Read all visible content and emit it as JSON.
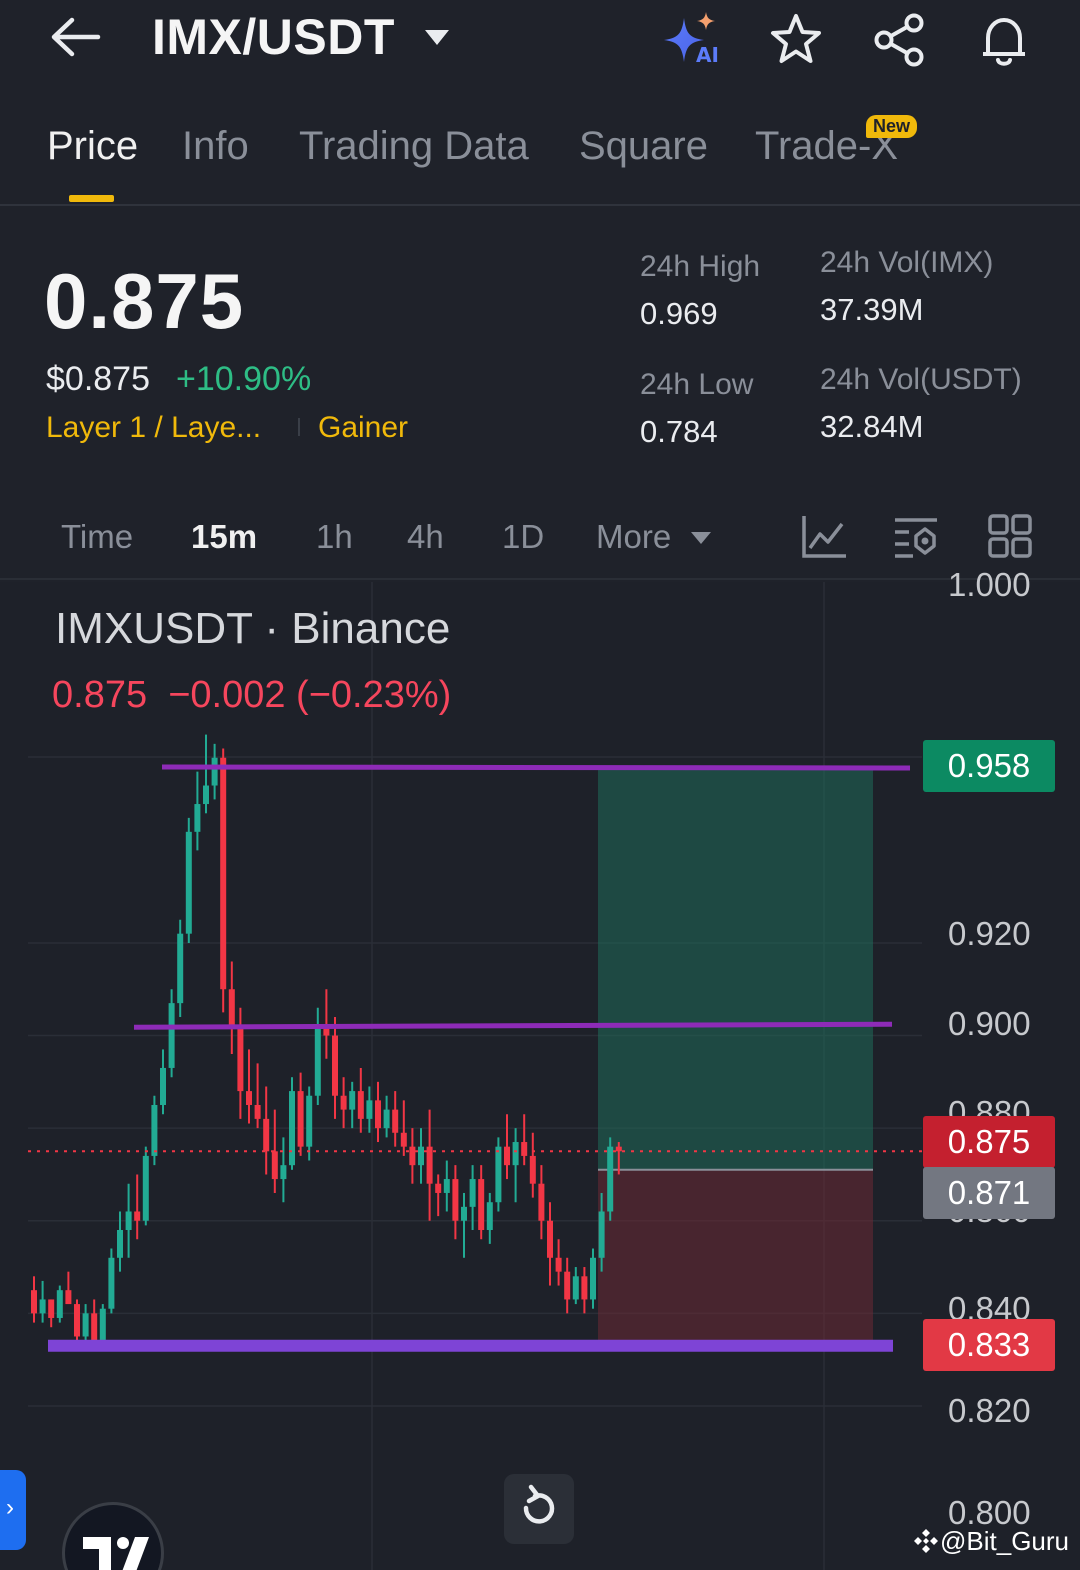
{
  "header": {
    "pair": "IMX/USDT",
    "icons": [
      "back-arrow-icon",
      "chevron-down-icon",
      "ai-sparkle-icon",
      "star-icon",
      "share-icon",
      "bell-icon"
    ]
  },
  "tabs": [
    {
      "label": "Price",
      "active": true
    },
    {
      "label": "Info"
    },
    {
      "label": "Trading Data"
    },
    {
      "label": "Square"
    },
    {
      "label": "Trade-X",
      "badge": "New"
    }
  ],
  "ticker": {
    "last": "0.875",
    "usd": "$0.875",
    "change": "+10.90%",
    "tag_sector": "Layer 1 / Laye...",
    "tag_gainer": "Gainer",
    "high_label": "24h High",
    "high": "0.969",
    "low_label": "24h Low",
    "low": "0.784",
    "vol_base_label": "24h Vol(IMX)",
    "vol_base": "37.39M",
    "vol_quote_label": "24h Vol(USDT)",
    "vol_quote": "32.84M"
  },
  "intervals": {
    "items": [
      "Time",
      "15m",
      "1h",
      "4h",
      "1D"
    ],
    "active": "15m",
    "more": "More",
    "tools": [
      "indicator-chart-icon",
      "chart-settings-icon",
      "layout-grid-icon"
    ]
  },
  "chart": {
    "title": "IMXUSDT · Binance",
    "ohlc": "0.875  −0.002 (−0.23%)",
    "y_ticks": [
      "1.000",
      "0.920",
      "0.900",
      "0.880",
      "0.860",
      "0.840",
      "0.820",
      "0.800"
    ],
    "tags": {
      "tp": "0.958",
      "last": "0.875",
      "entry": "0.871",
      "sl": "0.833"
    },
    "watermark": "@Bit_Guru"
  },
  "chart_data": {
    "type": "candlestick",
    "title": "IMXUSDT · Binance",
    "interval": "15m",
    "y_axis_ticks": [
      1.0,
      0.92,
      0.9,
      0.88,
      0.86,
      0.84,
      0.82,
      0.8
    ],
    "last_price": 0.875,
    "annotations": {
      "horizontal_lines": [
        0.958,
        0.902,
        0.833
      ],
      "long_position": {
        "entry": 0.871,
        "take_profit": 0.958,
        "stop_loss": 0.833
      }
    },
    "candles": [
      [
        0.845,
        0.848,
        0.838,
        0.84
      ],
      [
        0.84,
        0.847,
        0.838,
        0.843
      ],
      [
        0.843,
        0.843,
        0.837,
        0.839
      ],
      [
        0.839,
        0.846,
        0.838,
        0.845
      ],
      [
        0.845,
        0.849,
        0.843,
        0.842
      ],
      [
        0.842,
        0.843,
        0.834,
        0.835
      ],
      [
        0.835,
        0.842,
        0.834,
        0.84
      ],
      [
        0.84,
        0.843,
        0.833,
        0.834
      ],
      [
        0.834,
        0.842,
        0.833,
        0.841
      ],
      [
        0.841,
        0.854,
        0.84,
        0.852
      ],
      [
        0.852,
        0.862,
        0.849,
        0.858
      ],
      [
        0.858,
        0.868,
        0.852,
        0.862
      ],
      [
        0.862,
        0.87,
        0.856,
        0.86
      ],
      [
        0.86,
        0.876,
        0.859,
        0.874
      ],
      [
        0.874,
        0.887,
        0.872,
        0.885
      ],
      [
        0.885,
        0.897,
        0.883,
        0.893
      ],
      [
        0.893,
        0.91,
        0.891,
        0.907
      ],
      [
        0.907,
        0.925,
        0.904,
        0.922
      ],
      [
        0.922,
        0.947,
        0.92,
        0.944
      ],
      [
        0.944,
        0.957,
        0.94,
        0.95
      ],
      [
        0.95,
        0.965,
        0.948,
        0.954
      ],
      [
        0.954,
        0.963,
        0.951,
        0.96
      ],
      [
        0.96,
        0.962,
        0.905,
        0.91
      ],
      [
        0.91,
        0.916,
        0.896,
        0.902
      ],
      [
        0.902,
        0.906,
        0.882,
        0.888
      ],
      [
        0.888,
        0.897,
        0.881,
        0.885
      ],
      [
        0.885,
        0.894,
        0.88,
        0.882
      ],
      [
        0.882,
        0.889,
        0.87,
        0.875
      ],
      [
        0.875,
        0.884,
        0.866,
        0.869
      ],
      [
        0.869,
        0.878,
        0.864,
        0.872
      ],
      [
        0.872,
        0.891,
        0.871,
        0.888
      ],
      [
        0.888,
        0.892,
        0.874,
        0.876
      ],
      [
        0.876,
        0.889,
        0.873,
        0.887
      ],
      [
        0.887,
        0.906,
        0.885,
        0.902
      ],
      [
        0.902,
        0.91,
        0.895,
        0.9
      ],
      [
        0.9,
        0.904,
        0.882,
        0.887
      ],
      [
        0.887,
        0.891,
        0.88,
        0.884
      ],
      [
        0.884,
        0.89,
        0.88,
        0.888
      ],
      [
        0.888,
        0.893,
        0.879,
        0.882
      ],
      [
        0.882,
        0.889,
        0.879,
        0.886
      ],
      [
        0.886,
        0.89,
        0.877,
        0.88
      ],
      [
        0.88,
        0.887,
        0.878,
        0.884
      ],
      [
        0.884,
        0.888,
        0.876,
        0.879
      ],
      [
        0.879,
        0.886,
        0.874,
        0.876
      ],
      [
        0.876,
        0.88,
        0.868,
        0.872
      ],
      [
        0.872,
        0.88,
        0.868,
        0.876
      ],
      [
        0.876,
        0.884,
        0.86,
        0.868
      ],
      [
        0.868,
        0.87,
        0.861,
        0.866
      ],
      [
        0.866,
        0.873,
        0.862,
        0.869
      ],
      [
        0.869,
        0.872,
        0.856,
        0.86
      ],
      [
        0.86,
        0.866,
        0.852,
        0.863
      ],
      [
        0.863,
        0.872,
        0.858,
        0.869
      ],
      [
        0.869,
        0.872,
        0.856,
        0.858
      ],
      [
        0.858,
        0.866,
        0.855,
        0.864
      ],
      [
        0.864,
        0.878,
        0.862,
        0.876
      ],
      [
        0.876,
        0.883,
        0.869,
        0.872
      ],
      [
        0.872,
        0.88,
        0.864,
        0.877
      ],
      [
        0.877,
        0.883,
        0.872,
        0.874
      ],
      [
        0.874,
        0.879,
        0.865,
        0.868
      ],
      [
        0.868,
        0.872,
        0.856,
        0.86
      ],
      [
        0.86,
        0.864,
        0.846,
        0.852
      ],
      [
        0.852,
        0.856,
        0.846,
        0.849
      ],
      [
        0.849,
        0.852,
        0.84,
        0.843
      ],
      [
        0.843,
        0.85,
        0.842,
        0.848
      ],
      [
        0.848,
        0.85,
        0.84,
        0.843
      ],
      [
        0.843,
        0.854,
        0.841,
        0.852
      ],
      [
        0.852,
        0.866,
        0.849,
        0.862
      ],
      [
        0.862,
        0.878,
        0.86,
        0.876
      ],
      [
        0.876,
        0.877,
        0.87,
        0.875
      ]
    ]
  }
}
